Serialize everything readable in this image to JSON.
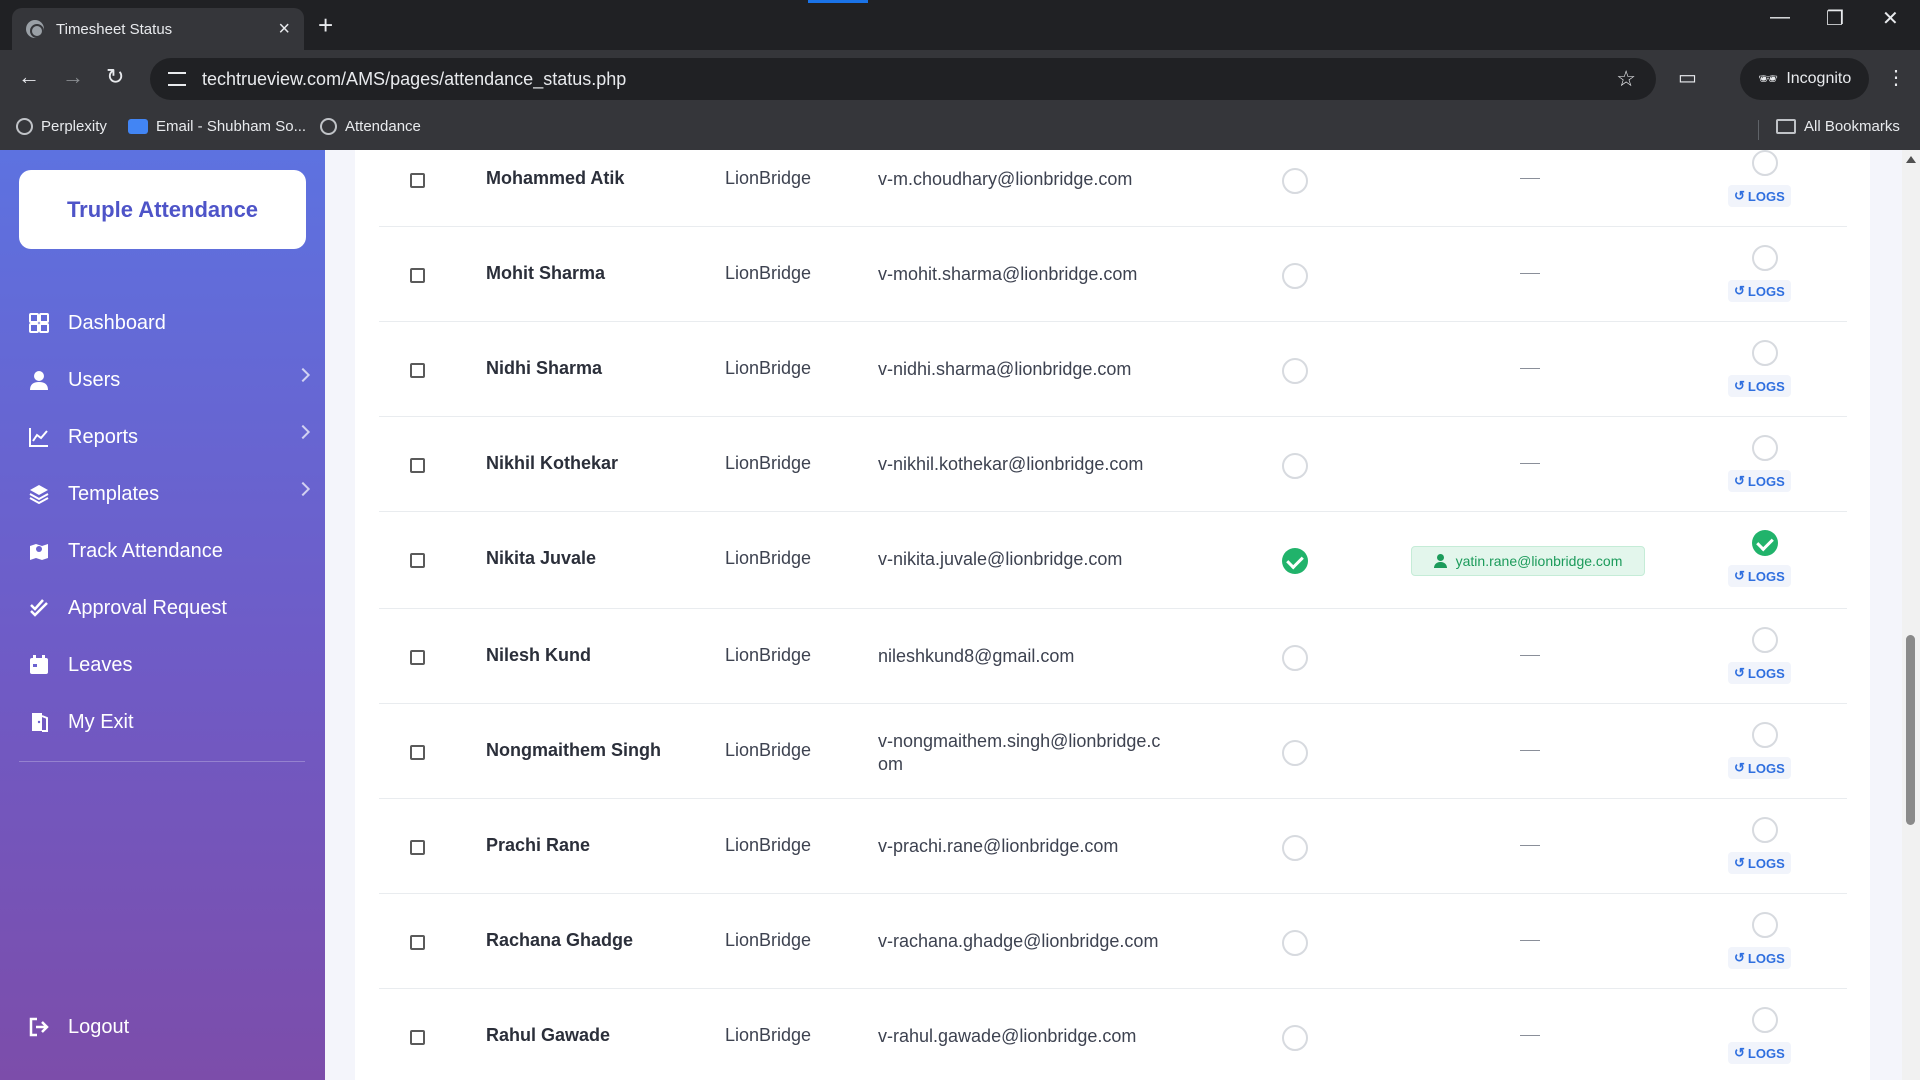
{
  "browser": {
    "tab_title": "Timesheet Status",
    "url": "techtrueview.com/AMS/pages/attendance_status.php",
    "incognito_label": "Incognito",
    "bookmarks": [
      "Perplexity",
      "Email - Shubham So...",
      "Attendance"
    ],
    "all_bookmarks": "All Bookmarks"
  },
  "sidebar": {
    "brand": "Truple Attendance",
    "items": [
      {
        "label": "Dashboard",
        "icon": "dashboard-icon"
      },
      {
        "label": "Users",
        "icon": "user-icon"
      },
      {
        "label": "Reports",
        "icon": "chart-icon"
      },
      {
        "label": "Templates",
        "icon": "layers-icon"
      },
      {
        "label": "Track Attendance",
        "icon": "map-icon"
      },
      {
        "label": "Approval Request",
        "icon": "check-double-icon"
      },
      {
        "label": "Leaves",
        "icon": "calendar-icon"
      },
      {
        "label": "My Exit",
        "icon": "door-icon"
      }
    ],
    "logout": "Logout"
  },
  "table": {
    "logs_label": "LOGS",
    "dash": "—",
    "rows": [
      {
        "name": "Mohammed Atik",
        "company": "LionBridge",
        "email": "v-m.choudhary@lionbridge.com",
        "approved": false,
        "approver": "",
        "final": false
      },
      {
        "name": "Mohit Sharma",
        "company": "LionBridge",
        "email": "v-mohit.sharma@lionbridge.com",
        "approved": false,
        "approver": "",
        "final": false
      },
      {
        "name": "Nidhi Sharma",
        "company": "LionBridge",
        "email": "v-nidhi.sharma@lionbridge.com",
        "approved": false,
        "approver": "",
        "final": false
      },
      {
        "name": "Nikhil Kothekar",
        "company": "LionBridge",
        "email": "v-nikhil.kothekar@lionbridge.com",
        "approved": false,
        "approver": "",
        "final": false
      },
      {
        "name": "Nikita Juvale",
        "company": "LionBridge",
        "email": "v-nikita.juvale@lionbridge.com",
        "approved": true,
        "approver": "yatin.rane@lionbridge.com",
        "final": true
      },
      {
        "name": "Nilesh Kund",
        "company": "LionBridge",
        "email": "nileshkund8@gmail.com",
        "approved": false,
        "approver": "",
        "final": false
      },
      {
        "name": "Nongmaithem Singh",
        "company": "LionBridge",
        "email": "v-nongmaithem.singh@lionbridge.com",
        "approved": false,
        "approver": "",
        "final": false
      },
      {
        "name": "Prachi Rane",
        "company": "LionBridge",
        "email": "v-prachi.rane@lionbridge.com",
        "approved": false,
        "approver": "",
        "final": false
      },
      {
        "name": "Rachana Ghadge",
        "company": "LionBridge",
        "email": "v-rachana.ghadge@lionbridge.com",
        "approved": false,
        "approver": "",
        "final": false
      },
      {
        "name": "Rahul Gawade",
        "company": "LionBridge",
        "email": "v-rahul.gawade@lionbridge.com",
        "approved": false,
        "approver": "",
        "final": false
      }
    ]
  },
  "colors": {
    "accent": "#4e54c8",
    "success": "#21b36b",
    "link": "#2f6fdf"
  }
}
